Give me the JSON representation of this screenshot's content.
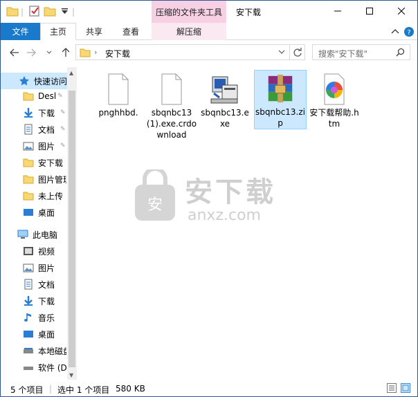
{
  "titlebar": {
    "context_tab": "压缩的文件夹工具",
    "window_title": "安下载"
  },
  "ribbon": {
    "file": "文件",
    "tabs": [
      "主页",
      "共享",
      "查看"
    ],
    "context_sub": "解压缩"
  },
  "address": {
    "path": "安下载",
    "search_placeholder": "搜索\"安下载\""
  },
  "sidebar": {
    "items": [
      "快速访问",
      "Desl",
      "下载",
      "文档",
      "图片",
      "安下载",
      "图片管理",
      "未上传",
      "桌面",
      "此电脑",
      "视频",
      "图片",
      "文档",
      "下载",
      "音乐",
      "桌面",
      "本地磁盘",
      "软件 (D"
    ]
  },
  "files": [
    {
      "name": "pnghhbd.",
      "icon": "blank-file-icon"
    },
    {
      "name": "sbqnbc13(1).exe.crdownload",
      "icon": "blank-file-icon"
    },
    {
      "name": "sbqnbc13.exe",
      "icon": "installer-icon"
    },
    {
      "name": "sbqnbc13.zip",
      "icon": "winrar-archive-icon"
    },
    {
      "name": "安下载帮助.htm",
      "icon": "colorful-browser-icon"
    }
  ],
  "watermark": {
    "brand": "安下载",
    "domain": "anxz.com"
  },
  "status": {
    "count": "5 个项目",
    "selected": "选中 1 个项目",
    "size": "580 KB"
  },
  "colors": {
    "accent": "#1979ca",
    "selection": "#cce8ff",
    "context_tab": "#f7d1e3"
  }
}
